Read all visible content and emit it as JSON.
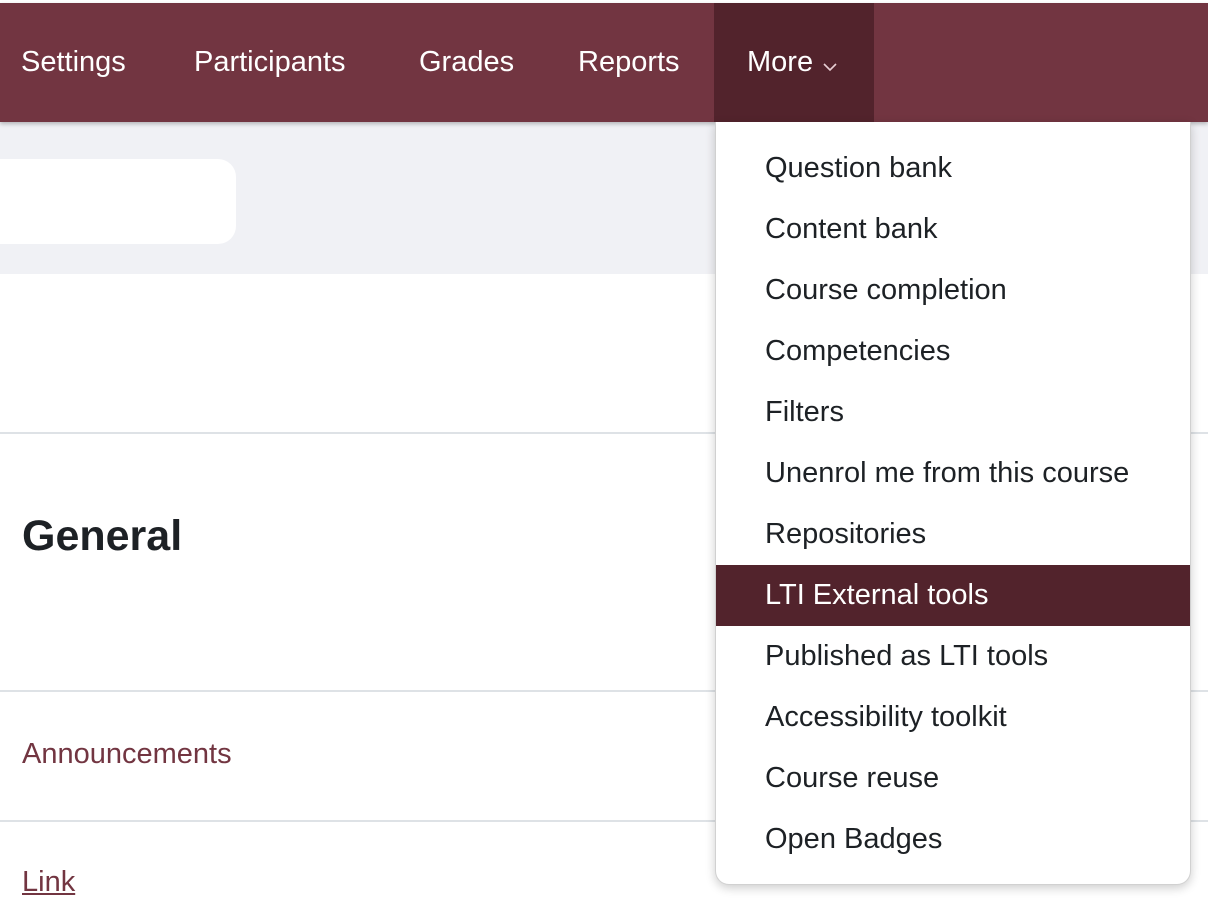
{
  "nav": {
    "items": [
      "Settings",
      "Participants",
      "Grades",
      "Reports"
    ],
    "more_label": "More",
    "chevron_icon": "chevron-down-icon"
  },
  "menu": {
    "items": [
      "Question bank",
      "Content bank",
      "Course completion",
      "Competencies",
      "Filters",
      "Unenrol me from this course",
      "Repositories",
      "LTI External tools",
      "Published as LTI tools",
      "Accessibility toolkit",
      "Course reuse",
      "Open Badges"
    ],
    "active_item": "LTI External tools"
  },
  "course": {
    "section_title": "General",
    "activities": [
      "Announcements",
      "Link"
    ]
  },
  "colors": {
    "brand": "#723541",
    "brand_dark": "#52232c",
    "header_band": "#f0f1f5",
    "text": "#1d2125"
  }
}
